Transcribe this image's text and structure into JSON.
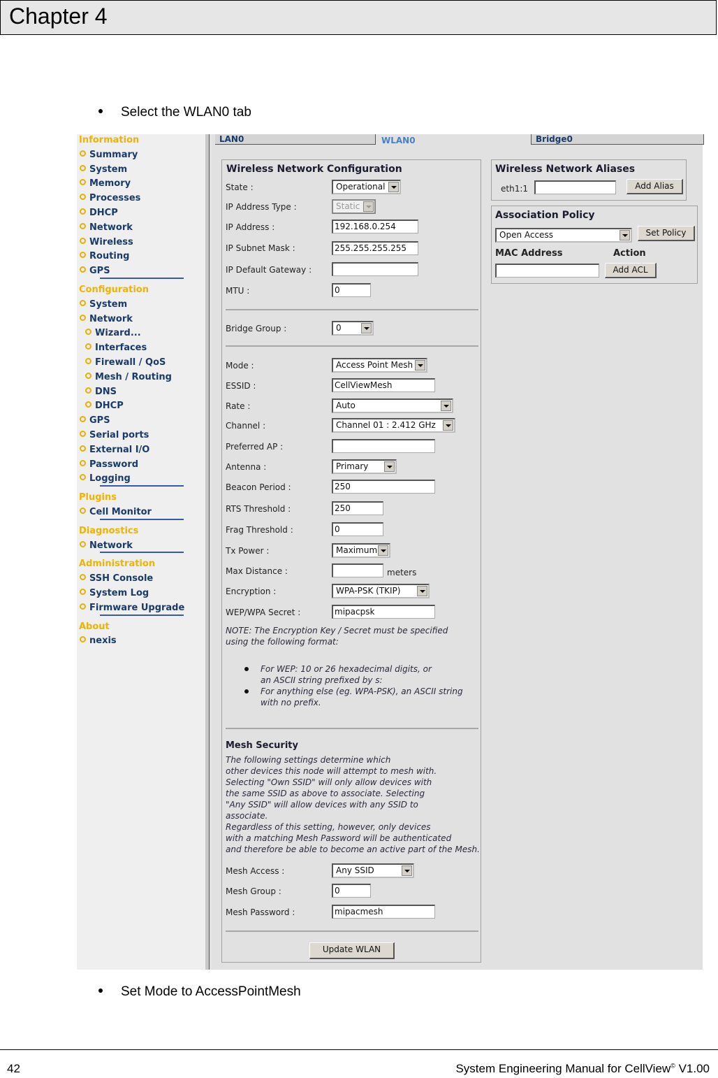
{
  "document": {
    "chapter": "Chapter 4",
    "step_1": "Select the WLAN0 tab",
    "step_2": "Set Mode to AccessPointMesh",
    "page_number": "42",
    "footer_title": "System Engineering Manual for CellView",
    "footer_mark": "©",
    "footer_version": " V1.00"
  },
  "sidebar": {
    "information": {
      "header": "Information",
      "items": [
        "Summary",
        "System",
        "Memory",
        "Processes",
        "DHCP",
        "Network",
        "Wireless",
        "Routing",
        "GPS"
      ]
    },
    "configuration": {
      "header": "Configuration",
      "items": [
        "System",
        "Network"
      ],
      "network_sub": [
        "Wizard...",
        "Interfaces",
        "Firewall / QoS",
        "Mesh / Routing",
        "DNS",
        "DHCP"
      ],
      "items_after": [
        "GPS",
        "Serial ports",
        "External I/O",
        "Password",
        "Logging"
      ]
    },
    "plugins": {
      "header": "Plugins",
      "items": [
        "Cell Monitor"
      ]
    },
    "diagnostics": {
      "header": "Diagnostics",
      "items": [
        "Network"
      ]
    },
    "administration": {
      "header": "Administration",
      "items": [
        "SSH Console",
        "System Log",
        "Firmware Upgrade"
      ]
    },
    "about": {
      "header": "About",
      "items": [
        "nexis"
      ]
    },
    "colors": {
      "header": "#f0b400",
      "item": "#1a3a6a"
    }
  },
  "tabs": [
    {
      "label": "LAN0",
      "active": false
    },
    {
      "label": "WLAN0",
      "active": true
    },
    {
      "label": "Bridge0",
      "active": false
    }
  ],
  "wireless_config": {
    "title": "Wireless Network Configuration",
    "state": {
      "label": "State :",
      "value": "Operational"
    },
    "ip_type": {
      "label": "IP Address Type :",
      "value": "Static"
    },
    "ip_address": {
      "label": "IP Address :",
      "value": "192.168.0.254"
    },
    "subnet": {
      "label": "IP Subnet Mask :",
      "value": "255.255.255.255"
    },
    "gateway": {
      "label": "IP Default Gateway :",
      "value": ""
    },
    "mtu": {
      "label": "MTU :",
      "value": "0"
    },
    "bridge_group": {
      "label": "Bridge Group :",
      "value": "0"
    },
    "mode": {
      "label": "Mode :",
      "value": "Access Point Mesh"
    },
    "essid": {
      "label": "ESSID :",
      "value": "CellViewMesh"
    },
    "rate": {
      "label": "Rate :",
      "value": "Auto"
    },
    "channel": {
      "label": "Channel :",
      "value": "Channel 01 : 2.412 GHz"
    },
    "preferred_ap": {
      "label": "Preferred AP :",
      "value": ""
    },
    "antenna": {
      "label": "Antenna :",
      "value": "Primary"
    },
    "beacon": {
      "label": "Beacon Period :",
      "value": "250"
    },
    "rts": {
      "label": "RTS Threshold :",
      "value": "250"
    },
    "frag": {
      "label": "Frag Threshold :",
      "value": "0"
    },
    "tx_power": {
      "label": "Tx Power :",
      "value": "Maximum"
    },
    "max_distance": {
      "label": "Max Distance :",
      "value": "",
      "unit": "meters"
    },
    "encryption": {
      "label": "Encryption :",
      "value": "WPA-PSK (TKIP)"
    },
    "secret": {
      "label": "WEP/WPA Secret :",
      "value": "mipacpsk"
    },
    "note": "NOTE: The Encryption Key / Secret must be specified\nusing the following format:",
    "note_bullets": [
      "For WEP: 10 or 26 hexadecimal digits, or\nan ASCII string prefixed by s:",
      "For anything else (eg. WPA-PSK), an ASCII string\nwith no prefix."
    ],
    "mesh_title": "Mesh Security",
    "mesh_note": "The following settings determine which\nother devices this node will attempt to mesh with.\nSelecting \"Own SSID\" will only allow devices with\nthe same SSID as above to associate. Selecting\n\"Any SSID\" will allow devices with any SSID to\nassociate.\nRegardless of this setting, however, only devices\nwith a matching Mesh Password will be authenticated\nand therefore be able to become an active part of the Mesh.",
    "mesh_access": {
      "label": "Mesh Access :",
      "value": "Any SSID"
    },
    "mesh_group": {
      "label": "Mesh Group :",
      "value": "0"
    },
    "mesh_password": {
      "label": "Mesh Password :",
      "value": "mipacmesh"
    },
    "update_button": "Update WLAN"
  },
  "aliases": {
    "title": "Wireless Network Aliases",
    "alias_label": "eth1:1",
    "alias_value": "",
    "add_button": "Add Alias"
  },
  "association": {
    "title": "Association Policy",
    "policy_value": "Open Access",
    "set_button": "Set Policy",
    "mac_header": "MAC Address",
    "action_header": "Action",
    "mac_value": "",
    "add_acl_button": "Add ACL"
  }
}
